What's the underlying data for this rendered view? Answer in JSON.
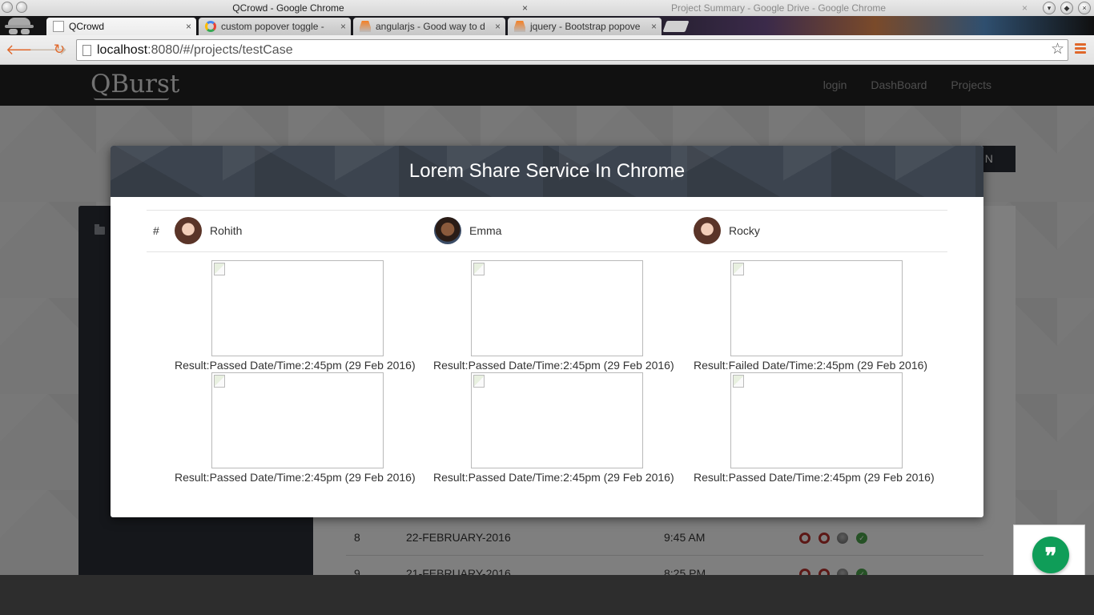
{
  "window": {
    "active_title": "QCrowd - Google Chrome",
    "other_title": "Project Summary - Google Drive - Google Chrome",
    "close_glyph": "×"
  },
  "tabs": [
    {
      "label": "QCrowd",
      "favicon": "page-icon"
    },
    {
      "label": "custom popover toggle -",
      "favicon": "google-icon"
    },
    {
      "label": "angularjs - Good way to d",
      "favicon": "stackoverflow-icon"
    },
    {
      "label": "jquery - Bootstrap popove",
      "favicon": "stackoverflow-icon"
    }
  ],
  "toolbar": {
    "back_glyph": "🡐",
    "forward_glyph": "🡒",
    "reload_glyph": "↻",
    "url_host": "localhost",
    "url_rest": ":8080/#/projects/testCase",
    "star_glyph": "☆"
  },
  "site": {
    "logo": "QBurst",
    "nav": [
      "login",
      "DashBoard",
      "Projects"
    ],
    "action_button": "ADD SESSION",
    "history_rows": [
      {
        "num": "8",
        "date": "22-FEBRUARY-2016",
        "time": "9:45 AM"
      },
      {
        "num": "9",
        "date": "21-FEBRUARY-2016",
        "time": "8:25 PM"
      }
    ]
  },
  "modal": {
    "title": "Lorem Share Service In Chrome",
    "hash": "#",
    "users": [
      {
        "name": "Rohith",
        "avatar": "female-avatar"
      },
      {
        "name": "Emma",
        "avatar": "male-avatar"
      },
      {
        "name": "Rocky",
        "avatar": "female-avatar"
      }
    ],
    "results": [
      [
        "Result:Passed Date/Time:2:45pm (29 Feb 2016)",
        "Result:Passed Date/Time:2:45pm (29 Feb 2016)",
        "Result:Failed Date/Time:2:45pm (29 Feb 2016)"
      ],
      [
        "Result:Passed Date/Time:2:45pm (29 Feb 2016)",
        "Result:Passed Date/Time:2:45pm (29 Feb 2016)",
        "Result:Passed Date/Time:2:45pm (29 Feb 2016)"
      ]
    ]
  },
  "hangouts": {
    "glyph": "❞",
    "color": "#0f9d58"
  },
  "colors": {
    "navbar": "#222222",
    "modal_header": "#3c444f",
    "sidebar": "#2b2f37",
    "status_red": "#b8302c",
    "status_green": "#4aa34a"
  }
}
